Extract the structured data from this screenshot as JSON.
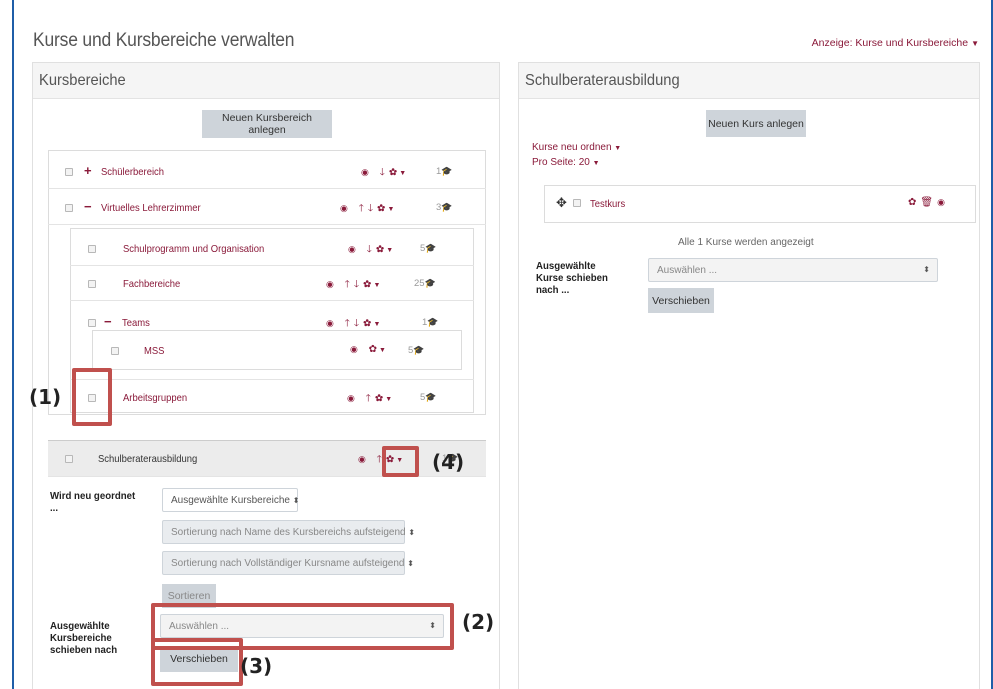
{
  "header": {
    "title": "Kurse und Kursbereiche verwalten",
    "view_label": "Anzeige: Kurse und Kursbereiche",
    "view_caret": "▼"
  },
  "left_panel": {
    "heading": "Kursbereiche",
    "new_category_button": "Neuen Kursbereich anlegen",
    "categories": [
      {
        "sign": "+",
        "name": "Schülerbereich",
        "count": "1"
      },
      {
        "sign": "−",
        "name": "Virtuelles Lehrerzimmer",
        "count": "3"
      },
      {
        "sign": "",
        "name": "Schulprogramm und Organisation",
        "count": "5"
      },
      {
        "sign": "",
        "name": "Fachbereiche",
        "count": "25"
      },
      {
        "sign": "−",
        "name": "Teams",
        "count": "1"
      },
      {
        "sign": "",
        "name": "MSS",
        "count": "5"
      },
      {
        "sign": "",
        "name": "Arbeitsgruppen",
        "count": "5"
      },
      {
        "sign": "",
        "name": "Schulberaterausbildung",
        "count": "1"
      }
    ],
    "resort": {
      "label": "Wird neu geordnet ...",
      "select1": "Ausgewählte Kursbereiche",
      "select2": "Sortierung nach Name des Kursbereichs aufsteigend",
      "select3": "Sortierung nach Vollständiger Kursname aufsteigend",
      "sort_button": "Sortieren"
    },
    "move": {
      "label": "Ausgewählte Kursbereiche schieben nach",
      "select": "Auswählen ...",
      "button": "Verschieben"
    }
  },
  "right_panel": {
    "heading": "Schulberaterausbildung",
    "new_course_button": "Neuen Kurs anlegen",
    "reorder_link": "Kurse neu ordnen",
    "per_page": "Pro Seite: 20",
    "courses": [
      {
        "name": "Testkurs"
      }
    ],
    "courses_shown": "Alle 1 Kurse werden angezeigt",
    "move": {
      "label": "Ausgewählte Kurse schieben nach ...",
      "select": "Auswählen ...",
      "button": "Verschieben"
    }
  },
  "annotations": {
    "m1": "(1)",
    "m2": "(2)",
    "m3": "(3)",
    "m4": "(4)",
    "highlight_color": "#c0504d"
  },
  "colors": {
    "link": "#8a1a3a",
    "button": "#ced4da"
  }
}
